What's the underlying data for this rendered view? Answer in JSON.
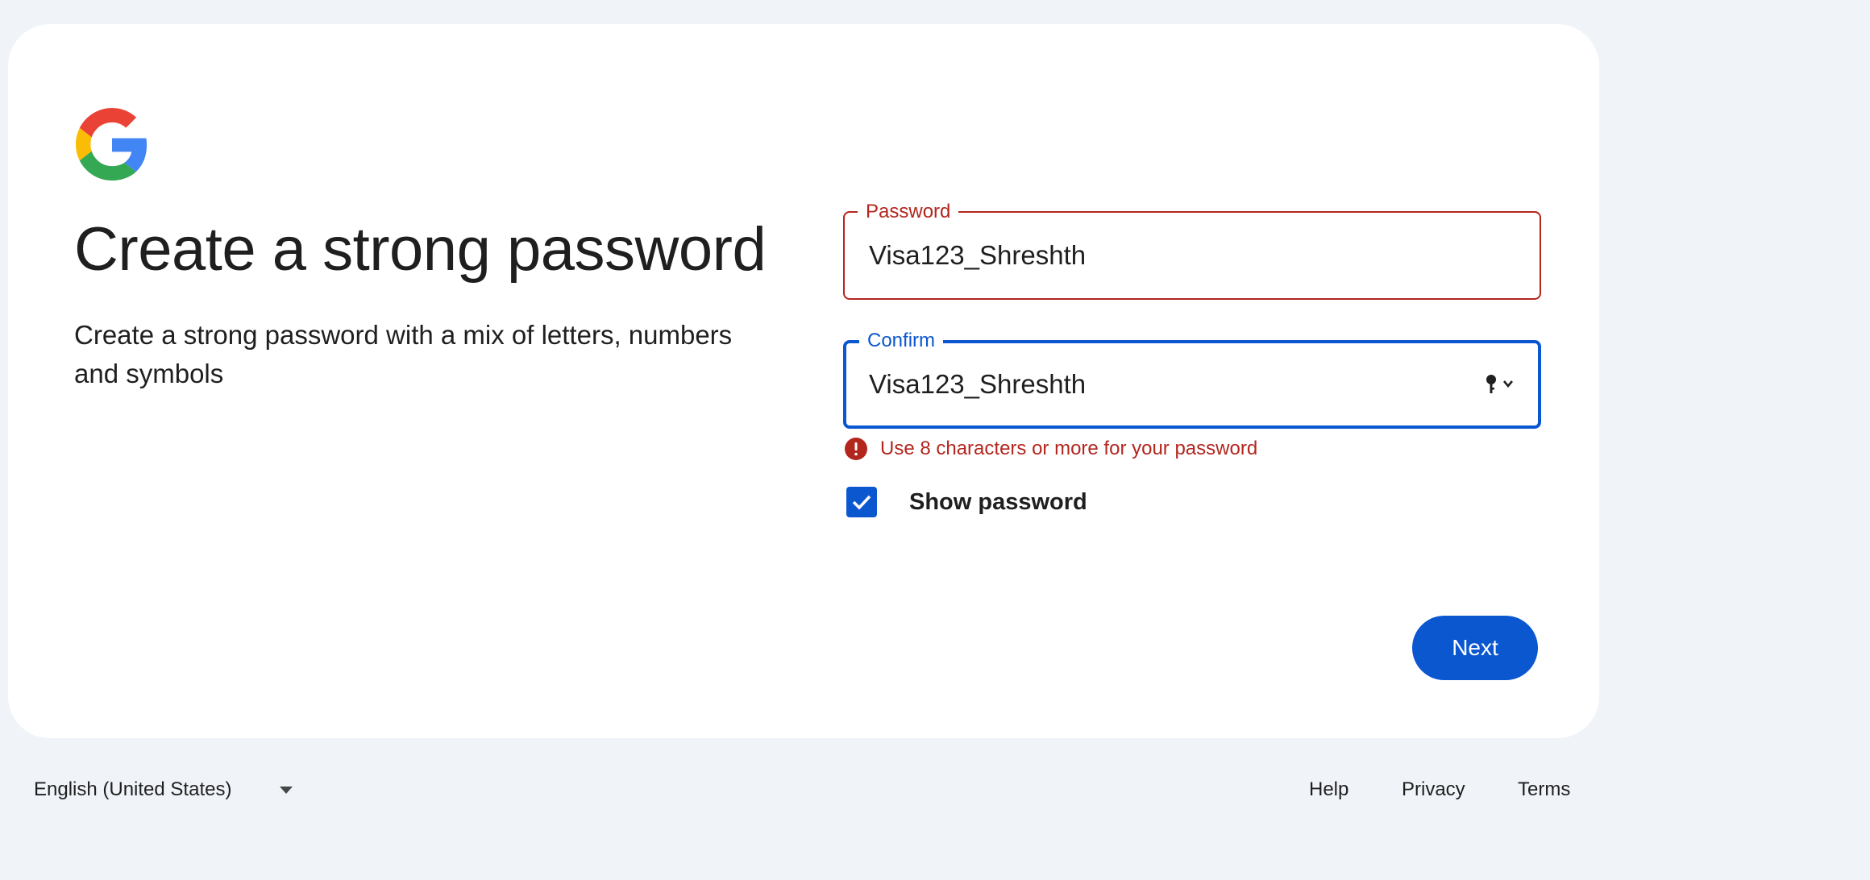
{
  "card": {
    "title": "Create a strong password",
    "subtitle": "Create a strong password with a mix of letters, numbers and symbols"
  },
  "password_field": {
    "label": "Password",
    "value": "Visa123_Shreshth"
  },
  "confirm_field": {
    "label": "Confirm",
    "value": "Visa123_Shreshth",
    "icon": "key-dropdown-icon"
  },
  "error": {
    "message": "Use 8 characters or more for your password",
    "icon": "error-icon"
  },
  "show_password": {
    "label": "Show password",
    "checked": true
  },
  "next_button": {
    "label": "Next"
  },
  "footer": {
    "language": "English (United States)",
    "links": [
      "Help",
      "Privacy",
      "Terms"
    ]
  },
  "colors": {
    "background": "#f0f4f9",
    "card": "#ffffff",
    "primary": "#0b57d0",
    "error": "#b3261e"
  }
}
